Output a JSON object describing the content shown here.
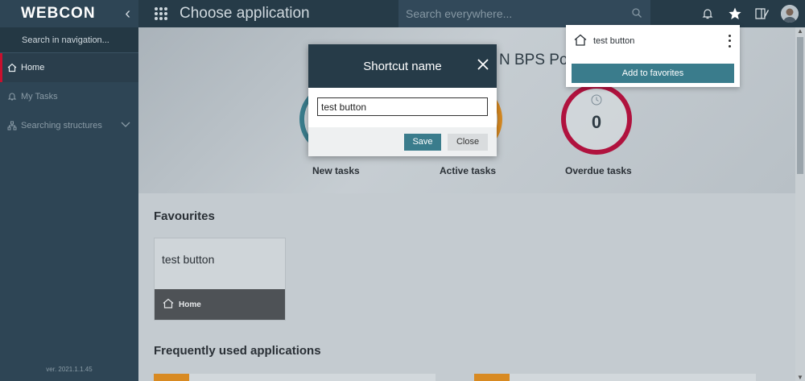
{
  "sidebar": {
    "logo": "WEBCON",
    "search_placeholder": "Search in navigation...",
    "items": [
      {
        "label": "Home",
        "icon": "home-icon",
        "active": true
      },
      {
        "label": "My Tasks",
        "icon": "bell-icon",
        "active": false
      },
      {
        "label": "Searching structures",
        "icon": "hierarchy-icon",
        "active": false
      }
    ],
    "version": "ver. 2021.1.1.45"
  },
  "topbar": {
    "title": "Choose application",
    "search_placeholder": "Search everywhere..."
  },
  "hero": {
    "portal_title_fragment": "N BPS Po",
    "tiles": [
      {
        "label": "New tasks",
        "color": "#3a7c8c"
      },
      {
        "label": "Active tasks",
        "color": "#d88a22"
      },
      {
        "label": "Overdue tasks",
        "color": "#b0123e",
        "count": "0"
      }
    ]
  },
  "favourites": {
    "title": "Favourites",
    "card": {
      "name": "test button",
      "footer": "Home"
    }
  },
  "frequent": {
    "title": "Frequently used applications"
  },
  "modal": {
    "title": "Shortcut name",
    "input_value": "test button",
    "save_label": "Save",
    "close_label": "Close"
  },
  "popup": {
    "item_label": "test button",
    "add_label": "Add to favorites"
  },
  "colors": {
    "accent": "#3a7c8c",
    "sidebar": "#2e4555",
    "topbar": "#263b48",
    "active_marker": "#c8102e"
  }
}
